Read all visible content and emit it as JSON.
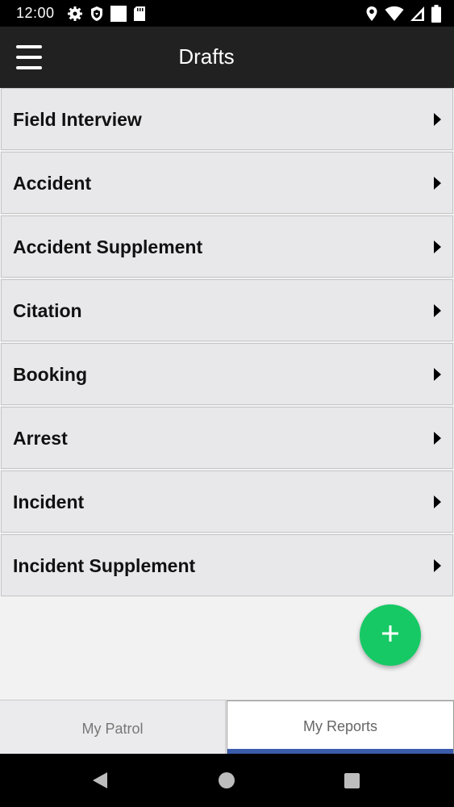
{
  "status_bar": {
    "time": "12:00",
    "left_icons": [
      "settings-icon",
      "shield-icon",
      "square-icon",
      "sd-card-icon"
    ],
    "right_icons": [
      "location-icon",
      "wifi-icon",
      "signal-icon",
      "battery-icon"
    ]
  },
  "app_bar": {
    "menu_icon": "hamburger-menu-icon",
    "title": "Drafts"
  },
  "drafts": [
    {
      "label": "Field Interview"
    },
    {
      "label": "Accident"
    },
    {
      "label": "Accident Supplement"
    },
    {
      "label": "Citation"
    },
    {
      "label": "Booking"
    },
    {
      "label": "Arrest"
    },
    {
      "label": "Incident"
    },
    {
      "label": "Incident Supplement"
    }
  ],
  "fab": {
    "icon": "plus-icon",
    "color": "#17c964"
  },
  "tabs": [
    {
      "label": "My Patrol",
      "selected": false
    },
    {
      "label": "My Reports",
      "selected": true
    }
  ],
  "colors": {
    "app_bar": "#212121",
    "tab_indicator": "#3b5bab",
    "list_item_bg": "#e8e7ea"
  }
}
